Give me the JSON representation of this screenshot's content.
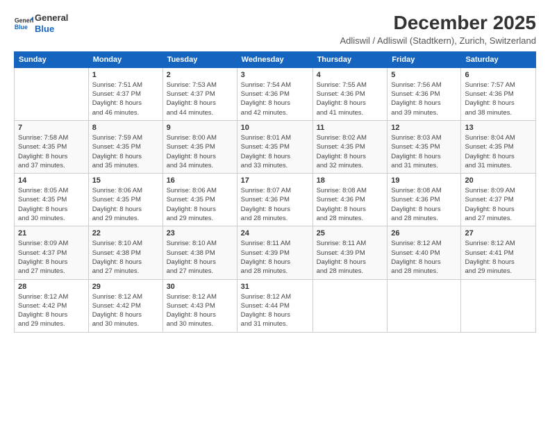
{
  "logo": {
    "general": "General",
    "blue": "Blue"
  },
  "header": {
    "month_year": "December 2025",
    "location": "Adliswil / Adliswil (Stadtkern), Zurich, Switzerland"
  },
  "weekdays": [
    "Sunday",
    "Monday",
    "Tuesday",
    "Wednesday",
    "Thursday",
    "Friday",
    "Saturday"
  ],
  "weeks": [
    [
      {
        "day": "",
        "info": ""
      },
      {
        "day": "1",
        "info": "Sunrise: 7:51 AM\nSunset: 4:37 PM\nDaylight: 8 hours\nand 46 minutes."
      },
      {
        "day": "2",
        "info": "Sunrise: 7:53 AM\nSunset: 4:37 PM\nDaylight: 8 hours\nand 44 minutes."
      },
      {
        "day": "3",
        "info": "Sunrise: 7:54 AM\nSunset: 4:36 PM\nDaylight: 8 hours\nand 42 minutes."
      },
      {
        "day": "4",
        "info": "Sunrise: 7:55 AM\nSunset: 4:36 PM\nDaylight: 8 hours\nand 41 minutes."
      },
      {
        "day": "5",
        "info": "Sunrise: 7:56 AM\nSunset: 4:36 PM\nDaylight: 8 hours\nand 39 minutes."
      },
      {
        "day": "6",
        "info": "Sunrise: 7:57 AM\nSunset: 4:36 PM\nDaylight: 8 hours\nand 38 minutes."
      }
    ],
    [
      {
        "day": "7",
        "info": "Sunrise: 7:58 AM\nSunset: 4:35 PM\nDaylight: 8 hours\nand 37 minutes."
      },
      {
        "day": "8",
        "info": "Sunrise: 7:59 AM\nSunset: 4:35 PM\nDaylight: 8 hours\nand 35 minutes."
      },
      {
        "day": "9",
        "info": "Sunrise: 8:00 AM\nSunset: 4:35 PM\nDaylight: 8 hours\nand 34 minutes."
      },
      {
        "day": "10",
        "info": "Sunrise: 8:01 AM\nSunset: 4:35 PM\nDaylight: 8 hours\nand 33 minutes."
      },
      {
        "day": "11",
        "info": "Sunrise: 8:02 AM\nSunset: 4:35 PM\nDaylight: 8 hours\nand 32 minutes."
      },
      {
        "day": "12",
        "info": "Sunrise: 8:03 AM\nSunset: 4:35 PM\nDaylight: 8 hours\nand 31 minutes."
      },
      {
        "day": "13",
        "info": "Sunrise: 8:04 AM\nSunset: 4:35 PM\nDaylight: 8 hours\nand 31 minutes."
      }
    ],
    [
      {
        "day": "14",
        "info": "Sunrise: 8:05 AM\nSunset: 4:35 PM\nDaylight: 8 hours\nand 30 minutes."
      },
      {
        "day": "15",
        "info": "Sunrise: 8:06 AM\nSunset: 4:35 PM\nDaylight: 8 hours\nand 29 minutes."
      },
      {
        "day": "16",
        "info": "Sunrise: 8:06 AM\nSunset: 4:35 PM\nDaylight: 8 hours\nand 29 minutes."
      },
      {
        "day": "17",
        "info": "Sunrise: 8:07 AM\nSunset: 4:36 PM\nDaylight: 8 hours\nand 28 minutes."
      },
      {
        "day": "18",
        "info": "Sunrise: 8:08 AM\nSunset: 4:36 PM\nDaylight: 8 hours\nand 28 minutes."
      },
      {
        "day": "19",
        "info": "Sunrise: 8:08 AM\nSunset: 4:36 PM\nDaylight: 8 hours\nand 28 minutes."
      },
      {
        "day": "20",
        "info": "Sunrise: 8:09 AM\nSunset: 4:37 PM\nDaylight: 8 hours\nand 27 minutes."
      }
    ],
    [
      {
        "day": "21",
        "info": "Sunrise: 8:09 AM\nSunset: 4:37 PM\nDaylight: 8 hours\nand 27 minutes."
      },
      {
        "day": "22",
        "info": "Sunrise: 8:10 AM\nSunset: 4:38 PM\nDaylight: 8 hours\nand 27 minutes."
      },
      {
        "day": "23",
        "info": "Sunrise: 8:10 AM\nSunset: 4:38 PM\nDaylight: 8 hours\nand 27 minutes."
      },
      {
        "day": "24",
        "info": "Sunrise: 8:11 AM\nSunset: 4:39 PM\nDaylight: 8 hours\nand 28 minutes."
      },
      {
        "day": "25",
        "info": "Sunrise: 8:11 AM\nSunset: 4:39 PM\nDaylight: 8 hours\nand 28 minutes."
      },
      {
        "day": "26",
        "info": "Sunrise: 8:12 AM\nSunset: 4:40 PM\nDaylight: 8 hours\nand 28 minutes."
      },
      {
        "day": "27",
        "info": "Sunrise: 8:12 AM\nSunset: 4:41 PM\nDaylight: 8 hours\nand 29 minutes."
      }
    ],
    [
      {
        "day": "28",
        "info": "Sunrise: 8:12 AM\nSunset: 4:42 PM\nDaylight: 8 hours\nand 29 minutes."
      },
      {
        "day": "29",
        "info": "Sunrise: 8:12 AM\nSunset: 4:42 PM\nDaylight: 8 hours\nand 30 minutes."
      },
      {
        "day": "30",
        "info": "Sunrise: 8:12 AM\nSunset: 4:43 PM\nDaylight: 8 hours\nand 30 minutes."
      },
      {
        "day": "31",
        "info": "Sunrise: 8:12 AM\nSunset: 4:44 PM\nDaylight: 8 hours\nand 31 minutes."
      },
      {
        "day": "",
        "info": ""
      },
      {
        "day": "",
        "info": ""
      },
      {
        "day": "",
        "info": ""
      }
    ]
  ]
}
